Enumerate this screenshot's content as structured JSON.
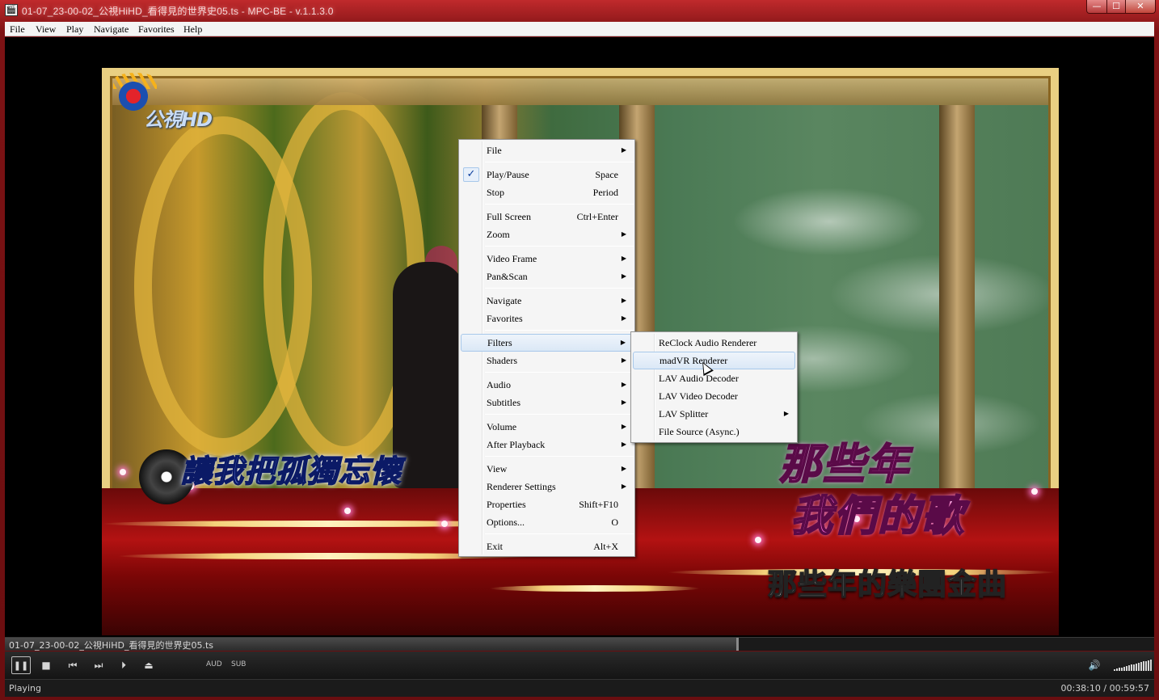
{
  "window": {
    "title": "01-07_23-00-02_公視HiHD_看得見的世界史05.ts - MPC-BE - v.1.1.3.0",
    "app_icon": "clapperboard-icon",
    "controls": {
      "minimize": "—",
      "maximize": "☐",
      "close": "✕"
    }
  },
  "menubar": [
    "File",
    "View",
    "Play",
    "Navigate",
    "Favorites",
    "Help"
  ],
  "video": {
    "channel_logo": "公視HD",
    "lyric": "讓我把孤獨忘懷",
    "show_title_line1": "那些年",
    "show_title_line2": "我們的歌",
    "banner": "那些年的樂團金曲"
  },
  "context_menu": {
    "items": [
      {
        "label": "File",
        "submenu": true
      },
      {
        "label": "Play/Pause",
        "shortcut": "Space",
        "checked": true
      },
      {
        "label": "Stop",
        "shortcut": "Period"
      },
      {
        "label": "Full Screen",
        "shortcut": "Ctrl+Enter"
      },
      {
        "label": "Zoom",
        "submenu": true
      },
      {
        "label": "Video Frame",
        "submenu": true
      },
      {
        "label": "Pan&Scan",
        "submenu": true
      },
      {
        "label": "Navigate",
        "submenu": true
      },
      {
        "label": "Favorites",
        "submenu": true
      },
      {
        "label": "Filters",
        "submenu": true,
        "highlighted": true
      },
      {
        "label": "Shaders",
        "submenu": true
      },
      {
        "label": "Audio",
        "submenu": true
      },
      {
        "label": "Subtitles",
        "submenu": true
      },
      {
        "label": "Volume",
        "submenu": true
      },
      {
        "label": "After Playback",
        "submenu": true
      },
      {
        "label": "View",
        "submenu": true
      },
      {
        "label": "Renderer Settings",
        "submenu": true
      },
      {
        "label": "Properties",
        "shortcut": "Shift+F10"
      },
      {
        "label": "Options...",
        "shortcut": "O"
      },
      {
        "label": "Exit",
        "shortcut": "Alt+X"
      }
    ],
    "check_glyph": "✓",
    "arrow_glyph": "▶"
  },
  "filters_submenu": {
    "items": [
      {
        "label": "ReClock Audio Renderer"
      },
      {
        "label": "madVR Renderer",
        "highlighted": true
      },
      {
        "label": "LAV Audio Decoder"
      },
      {
        "label": "LAV Video Decoder"
      },
      {
        "label": "LAV Splitter",
        "submenu": true
      },
      {
        "label": "File Source (Async.)"
      }
    ]
  },
  "seekbar": {
    "file_name": "01-07_23-00-02_公視HiHD_看得見的世界史05.ts",
    "progress": 0.6362
  },
  "toolbar": {
    "pause_glyph": "❚❚",
    "stop_glyph": "■",
    "prev_glyph": "⏮",
    "next_glyph": "⏭",
    "frame_step_glyph": "⏵",
    "eject_glyph": "⏏",
    "audio_tag": "AUD",
    "subtitle_tag": "SUB",
    "volume_glyph": "🔊",
    "volume_level": 1.0
  },
  "statusbar": {
    "status": "Playing",
    "time": "00:38:10 / 00:59:57"
  }
}
